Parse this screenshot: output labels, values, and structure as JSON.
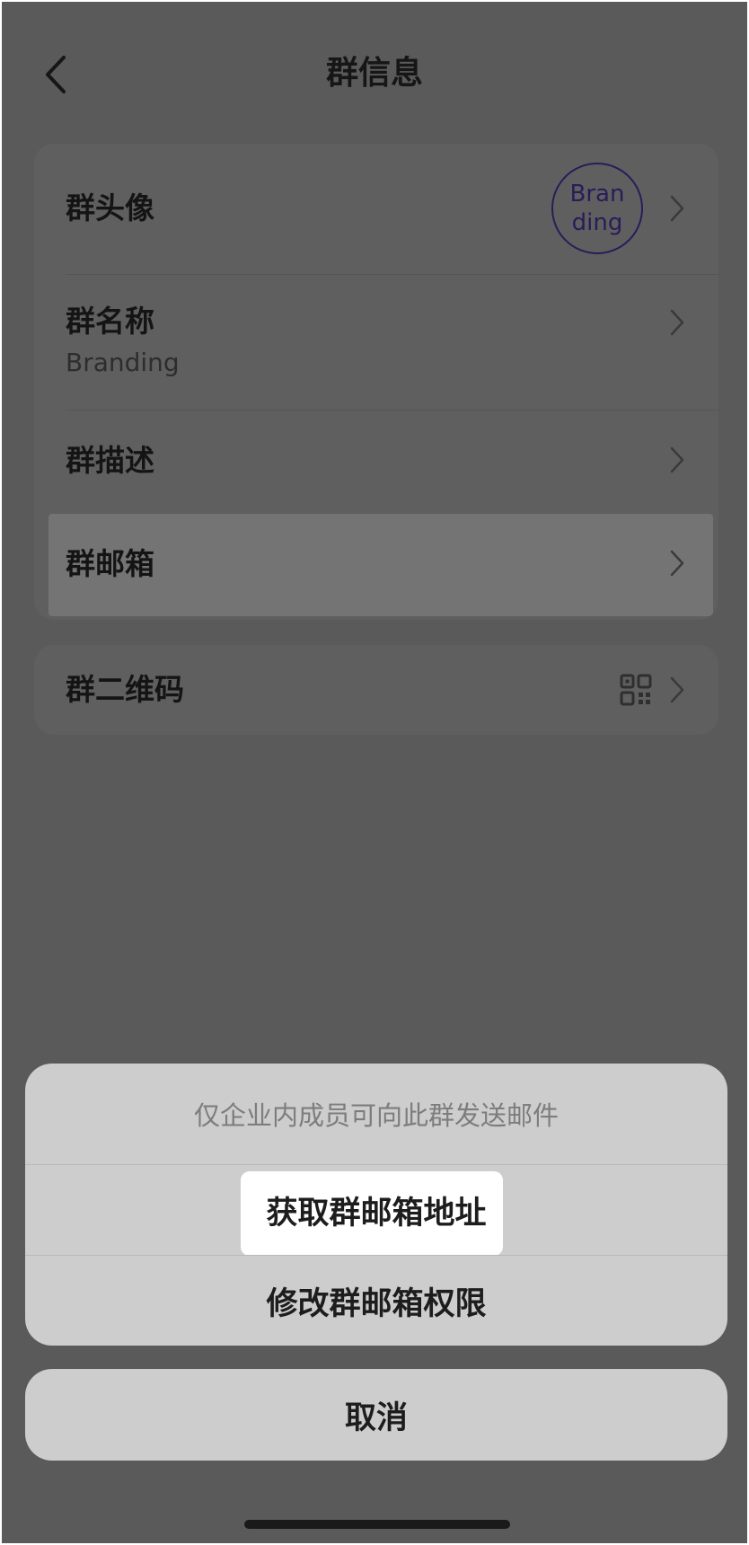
{
  "header": {
    "title": "群信息"
  },
  "card1": {
    "rows": [
      {
        "label": "群头像",
        "avatar_text": "Branding"
      },
      {
        "label": "群名称",
        "value": "Branding"
      },
      {
        "label": "群描述"
      },
      {
        "label": "群邮箱"
      }
    ]
  },
  "card2": {
    "rows": [
      {
        "label": "群二维码"
      }
    ]
  },
  "sheet": {
    "hint": "仅企业内成员可向此群发送邮件",
    "option1": "获取群邮箱地址",
    "option2": "修改群邮箱权限",
    "cancel": "取消"
  },
  "colors": {
    "overlay_bg": "#5a5a5a",
    "sheet_bg": "#cdcdcd",
    "avatar_accent": "#2a1c59",
    "focus_highlight": "#ffffff"
  },
  "icons": [
    "chevron-left-icon",
    "chevron-right-icon",
    "qr-code-icon"
  ]
}
